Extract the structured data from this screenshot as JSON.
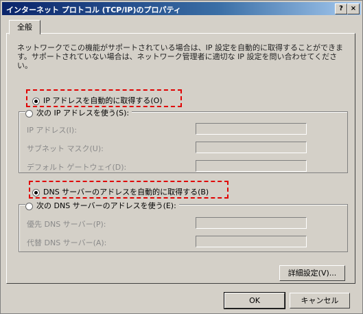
{
  "window": {
    "title": "インターネット プロトコル (TCP/IP)のプロパティ",
    "help_glyph": "?",
    "close_glyph": "×"
  },
  "tabs": [
    {
      "label": "全般"
    }
  ],
  "description": "ネットワークでこの機能がサポートされている場合は、IP 設定を自動的に取得することができます。サポートされていない場合は、ネットワーク管理者に適切な IP 設定を問い合わせてください。",
  "ip": {
    "auto_label": "IP アドレスを自動的に取得する(O)",
    "manual_label": "次の IP アドレスを使う(S):",
    "selected": "auto",
    "fields": [
      {
        "label": "IP アドレス(I):",
        "value": ""
      },
      {
        "label": "サブネット マスク(U):",
        "value": ""
      },
      {
        "label": "デフォルト ゲートウェイ(D):",
        "value": ""
      }
    ]
  },
  "dns": {
    "auto_label": "DNS サーバーのアドレスを自動的に取得する(B)",
    "manual_label": "次の DNS サーバーのアドレスを使う(E):",
    "selected": "auto",
    "fields": [
      {
        "label": "優先 DNS サーバー(P):",
        "value": ""
      },
      {
        "label": "代替 DNS サーバー(A):",
        "value": ""
      }
    ]
  },
  "buttons": {
    "advanced": "詳細設定(V)...",
    "ok": "OK",
    "cancel": "キャンセル"
  },
  "highlight_color": "#e00000"
}
